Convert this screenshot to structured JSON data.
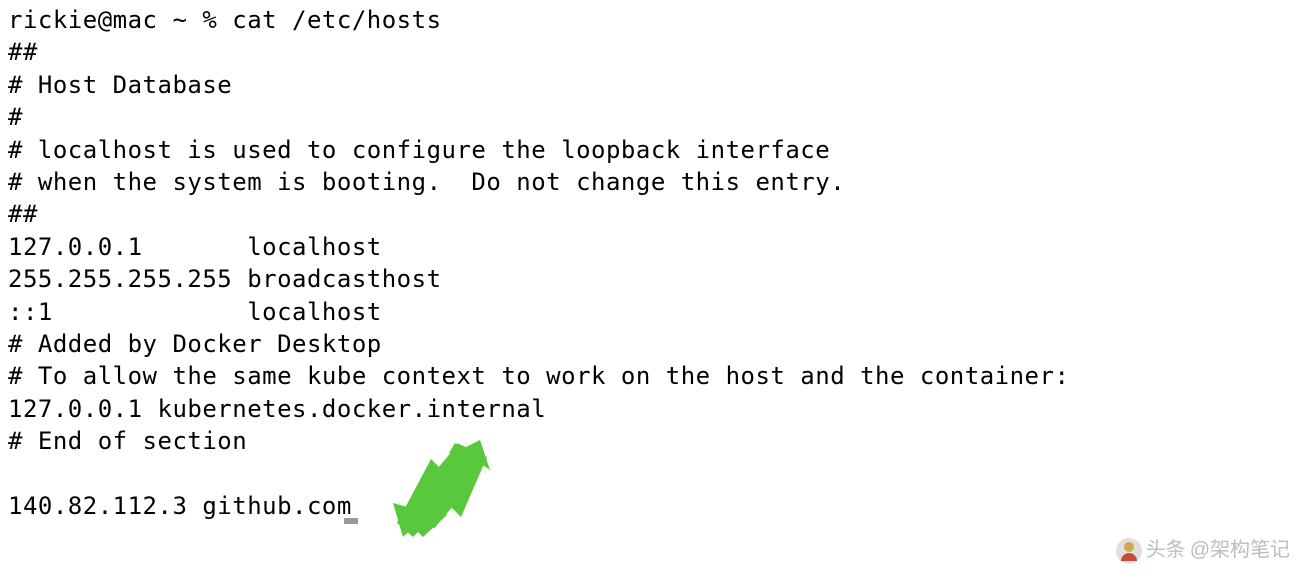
{
  "prompt": {
    "user": "rickie",
    "host": "mac",
    "cwd": "~",
    "symbol": "%",
    "command": "cat /etc/hosts",
    "full": "rickie@mac ~ % cat /etc/hosts"
  },
  "output_lines": [
    "##",
    "# Host Database",
    "#",
    "# localhost is used to configure the loopback interface",
    "# when the system is booting.  Do not change this entry.",
    "##",
    "127.0.0.1       localhost",
    "255.255.255.255 broadcasthost",
    "::1             localhost",
    "# Added by Docker Desktop",
    "# To allow the same kube context to work on the host and the container:",
    "127.0.0.1 kubernetes.docker.internal",
    "# End of section",
    "",
    "140.82.112.3 github.com"
  ],
  "arrow": {
    "color": "#5ac83c"
  },
  "watermark": {
    "prefix": "头条",
    "handle": "@架构笔记"
  }
}
